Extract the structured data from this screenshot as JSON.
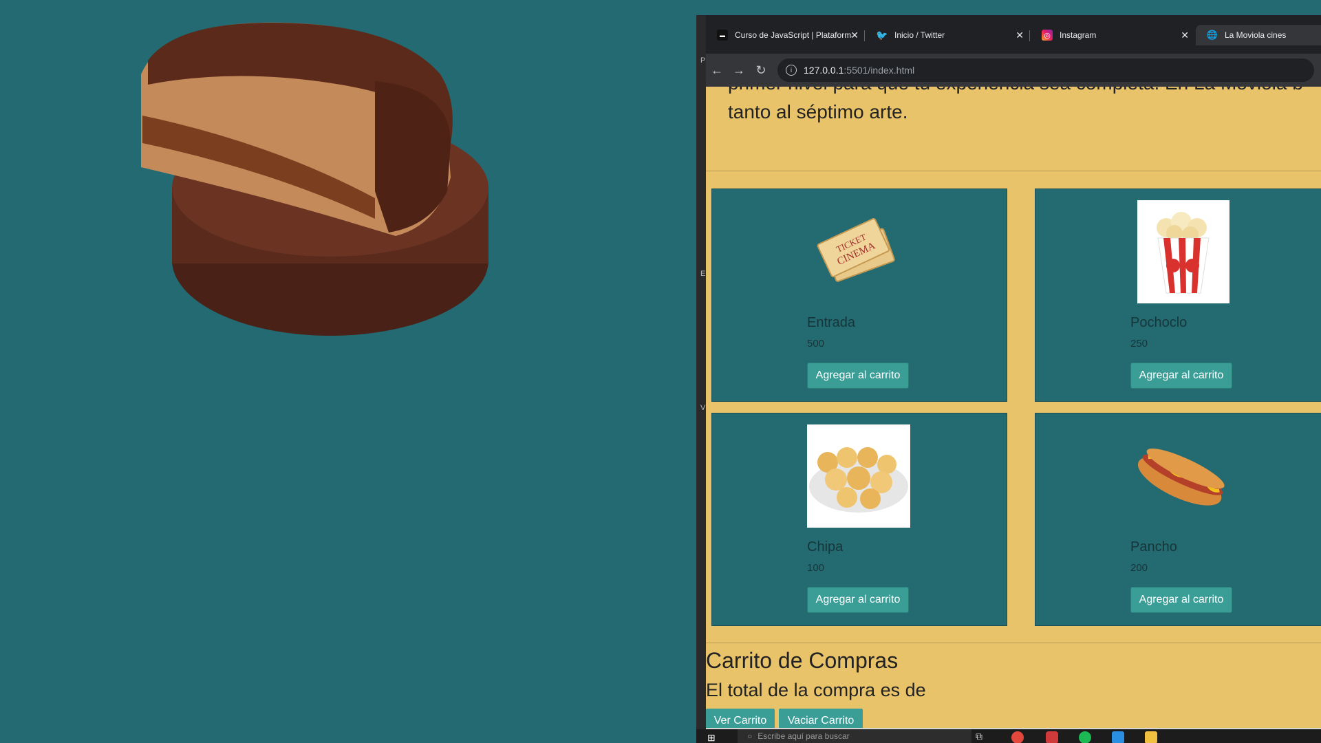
{
  "browser": {
    "tabs": [
      {
        "title": "Curso de JavaScript | Plataforma",
        "favicon": "coderhouse-icon"
      },
      {
        "title": "Inicio / Twitter",
        "favicon": "twitter-icon"
      },
      {
        "title": "Instagram",
        "favicon": "instagram-icon"
      },
      {
        "title": "La Moviola cines",
        "favicon": "globe-icon"
      }
    ],
    "url_host": "127.0.0.1",
    "url_path": ":5501/index.html"
  },
  "page": {
    "intro_line1": "primer nivel para que tu experiencia sea completa. En La Moviola b",
    "intro_line2": "tanto al séptimo arte.",
    "products": [
      {
        "name": "Entrada",
        "price": "500",
        "button": "Agregar al carrito",
        "image": "cinema-ticket-icon"
      },
      {
        "name": "Pochoclo",
        "price": "250",
        "button": "Agregar al carrito",
        "image": "popcorn-icon"
      },
      {
        "name": "Chipa",
        "price": "100",
        "button": "Agregar al carrito",
        "image": "chipa-icon"
      },
      {
        "name": "Pancho",
        "price": "200",
        "button": "Agregar al carrito",
        "image": "hotdog-icon"
      }
    ],
    "cart_title": "Carrito de Compras",
    "cart_total": "El total de la compra es de",
    "view_cart": "Ver Carrito",
    "empty_cart": "Vaciar Carrito"
  },
  "taskbar": {
    "search_placeholder": "Escribe aquí para buscar"
  },
  "colors": {
    "desktop": "#236a72",
    "page_bg": "#e8c36a",
    "card_bg": "#246a71",
    "button": "#3a9e97"
  }
}
